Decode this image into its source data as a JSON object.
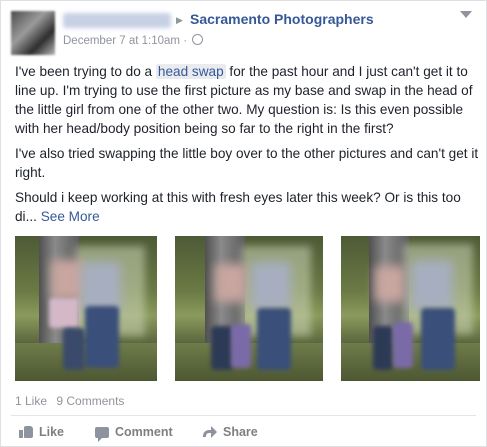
{
  "post": {
    "group_name": "Sacramento Photographers",
    "timestamp": "December 7 at 1:10am",
    "separator": "·",
    "icons": {
      "audience": "globe-icon",
      "menu": "chevron-down-icon",
      "arrow": "right-arrow-icon"
    }
  },
  "content": {
    "p1_before": "I've been trying to do a ",
    "p1_link": "head swap",
    "p1_after": " for the past hour and I just can't get it to line up. I'm trying to use the first picture as my base and swap in the head of the little girl from one of the other two. My question is: Is this even possible with her head/body position being so far to the right in the first?",
    "p2": "I've also tried swapping the little boy over to the other pictures and can't get it right.",
    "p3": "Should i keep working at this with fresh eyes later this week? Or is this too di...",
    "see_more": "See More"
  },
  "photos": [
    {
      "name": "photo-1"
    },
    {
      "name": "photo-2"
    },
    {
      "name": "photo-3"
    }
  ],
  "stats": {
    "likes": "1 Like",
    "comments": "9 Comments"
  },
  "actions": {
    "like": "Like",
    "comment": "Comment",
    "share": "Share"
  },
  "colors": {
    "link": "#365899",
    "muted": "#90949c",
    "text": "#1d2129"
  }
}
